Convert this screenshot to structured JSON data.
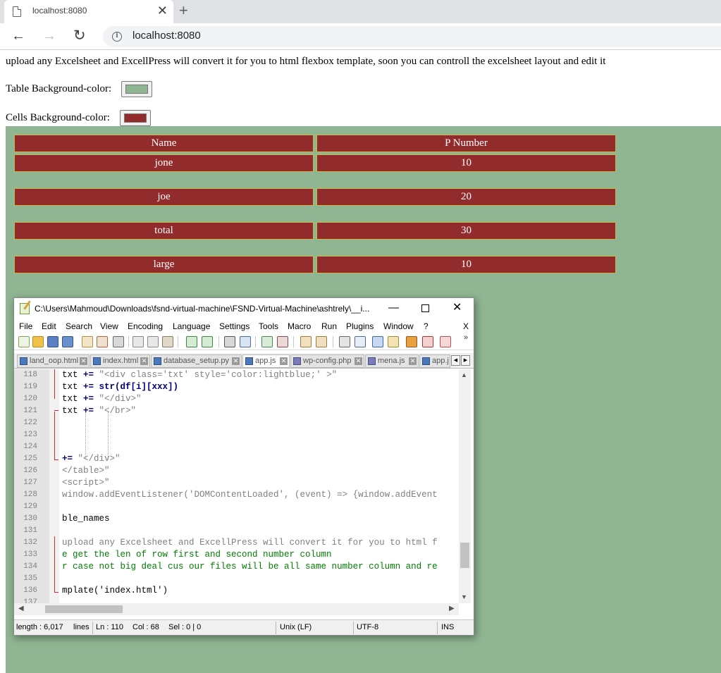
{
  "browser": {
    "tab_title": "localhost:8080",
    "close_glyph": "✕",
    "new_tab_glyph": "+",
    "url": "localhost:8080",
    "back_glyph": "←",
    "forward_glyph": "→",
    "reload_glyph": "↻",
    "info_glyph": "i"
  },
  "page": {
    "intro": "upload any Excelsheet and ExcellPress will convert it for you to html flexbox template, soon you can controll the excelsheet layout and edit it",
    "table_bg_label": "Table Background-color:",
    "table_bg_color": "#8fb592",
    "cells_bg_label": "Cells Background-color:",
    "cells_bg_color": "#922b2b"
  },
  "table": {
    "headers": [
      "Name",
      "P Number"
    ],
    "rows": [
      [
        "jone",
        "10"
      ],
      [
        "joe",
        "20"
      ],
      [
        "total",
        "30"
      ],
      [
        "large",
        "10"
      ]
    ]
  },
  "npp": {
    "title": "C:\\Users\\Mahmoud\\Downloads\\fsnd-virtual-machine\\FSND-Virtual-Machine\\ashtrely\\__i...",
    "min_glyph": "—",
    "close_glyph": "✕",
    "menu": [
      "File",
      "Edit",
      "Search",
      "View",
      "Encoding",
      "Language",
      "Settings",
      "Tools",
      "Macro",
      "Run",
      "Plugins",
      "Window",
      "?"
    ],
    "menu_close": "X",
    "toolbar_more": "»",
    "tabs": [
      "land_oop.html",
      "index.html",
      "database_setup.py",
      "app.js",
      "wp-config.php",
      "mena.js",
      "app.j"
    ],
    "tab_close_glyph": "✕",
    "tab_prev": "◀",
    "tab_next": "▶",
    "lines": [
      "118",
      "119",
      "120",
      "121",
      "122",
      "123",
      "124",
      "125",
      "126",
      "127",
      "128",
      "129",
      "130",
      "131",
      "132",
      "133",
      "134",
      "135",
      "136",
      "137"
    ],
    "code": {
      "l118_a": "txt ",
      "l118_b": "+=",
      "l118_c": " \"<div class='txt' style='color:lightblue;' >\"",
      "l119_a": "txt ",
      "l119_b": "+=",
      "l119_c": " str",
      "l119_d": "(df[i][xxx])",
      "l120_a": "txt ",
      "l120_b": "+=",
      "l120_c": " \"</div>\"",
      "l121_a": "txt ",
      "l121_b": "+=",
      "l121_c": " \"</br>\"",
      "l125_a": "+=",
      "l125_b": " \"</div>\"",
      "l126": "</table>\"",
      "l127": "<script>\"",
      "l128": "window.addEventListener('DOMContentLoaded', (event) => {window.addEvent",
      "l130": "ble_names",
      "l132": "upload any Excelsheet and ExcellPress will convert it for you to html f",
      "l133": "e get the len of row first and second number column",
      "l134": "r case not big deal cus our files will be all same number column and re",
      "l136": "mplate('index.html')"
    },
    "scroll_up": "▲",
    "scroll_down": "▼",
    "scroll_left": "◀",
    "scroll_right": "▶",
    "status": {
      "length": "length : 6,017",
      "lines": "lines",
      "ln": "Ln : 110",
      "col": "Col : 68",
      "sel": "Sel : 0 | 0",
      "eol": "Unix (LF)",
      "encoding": "UTF-8",
      "mode": "INS"
    }
  }
}
